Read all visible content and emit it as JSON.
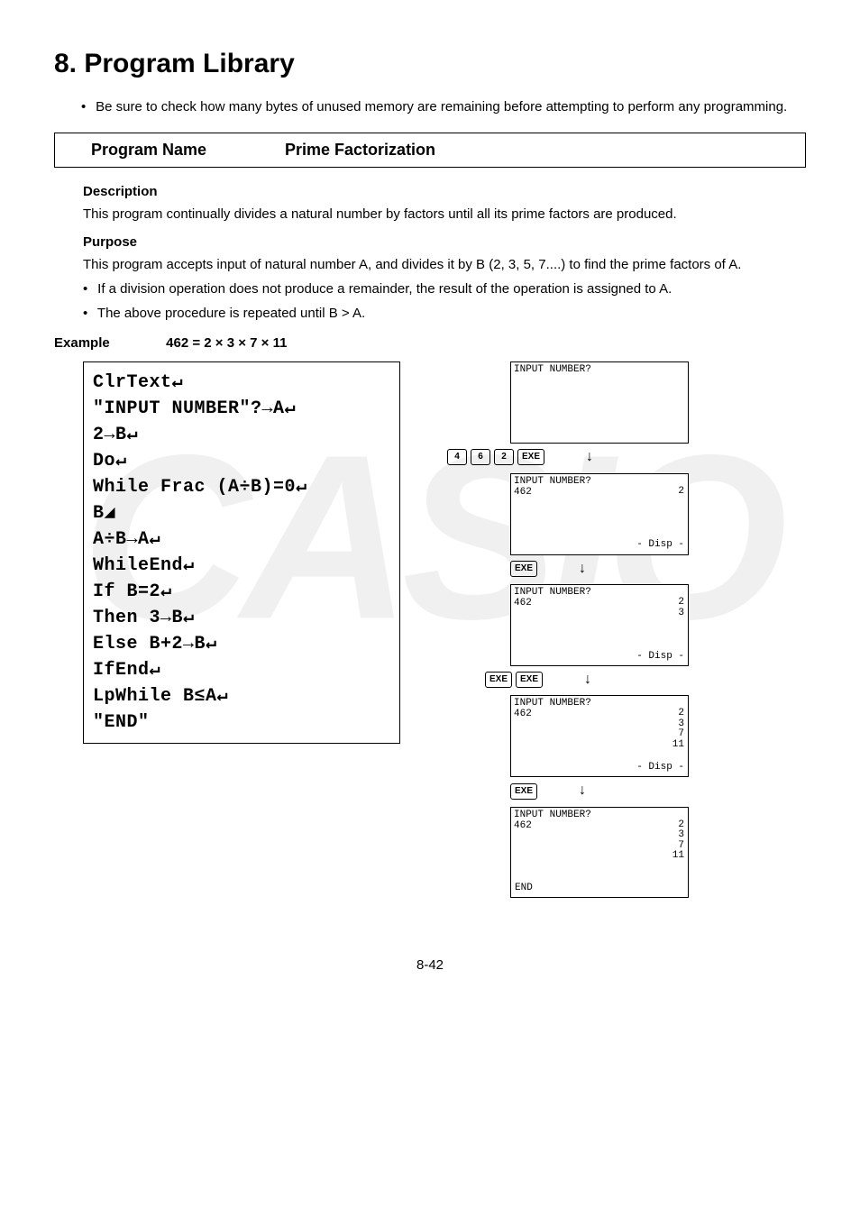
{
  "watermark": "CASIO",
  "title": "8. Program Library",
  "intro_bullet": "Be sure to check how many bytes of unused memory are remaining before attempting to perform any programming.",
  "program_box": {
    "label": "Program Name",
    "value": "Prime Factorization"
  },
  "description": {
    "title": "Description",
    "text": "This program continually divides a natural number by factors until all its prime factors are produced."
  },
  "purpose": {
    "title": "Purpose",
    "text": "This program accepts input of natural number A, and divides it by B (2, 3, 5, 7....) to find the prime factors of A.",
    "b1": "If a division operation does not produce a remainder, the result of the operation is assigned to A.",
    "b2": "The above procedure is repeated until B > A."
  },
  "example": {
    "label": "Example",
    "eq": "462 = 2 × 3 × 7 × 11"
  },
  "code": {
    "l1": "ClrText↵",
    "l2": "\"INPUT NUMBER\"?→A↵",
    "l3": "2→B↵",
    "l4": "Do↵",
    "l5": "While Frac (A÷B)=0↵",
    "l6": "B◢",
    "l7": "A÷B→A↵",
    "l8": "WhileEnd↵",
    "l9": "If B=2↵",
    "l10": "Then 3→B↵",
    "l11": "Else B+2→B↵",
    "l12": "IfEnd↵",
    "l13": "LpWhile B≤A↵",
    "l14": "\"END\""
  },
  "screens": {
    "s1": {
      "l1": "INPUT NUMBER?"
    },
    "keys1": {
      "k1": "4",
      "k2": "6",
      "k3": "2",
      "k4": "EXE"
    },
    "s2": {
      "l1": "INPUT NUMBER?",
      "l2": "462",
      "r1": "2",
      "disp": "- Disp -"
    },
    "keys2": {
      "k1": "EXE"
    },
    "s3": {
      "l1": "INPUT NUMBER?",
      "l2": "462",
      "r1": "2",
      "r2": "3",
      "disp": "- Disp -"
    },
    "keys3": {
      "k1": "EXE",
      "k2": "EXE"
    },
    "s4": {
      "l1": "INPUT NUMBER?",
      "l2": "462",
      "r1": "2",
      "r2": "3",
      "r3": "7",
      "r4": "11",
      "disp": "- Disp -"
    },
    "keys4": {
      "k1": "EXE"
    },
    "s5": {
      "l1": "INPUT NUMBER?",
      "l2": "462",
      "r1": "2",
      "r2": "3",
      "r3": "7",
      "r4": "11",
      "end": "END"
    }
  },
  "footer": "8-42"
}
